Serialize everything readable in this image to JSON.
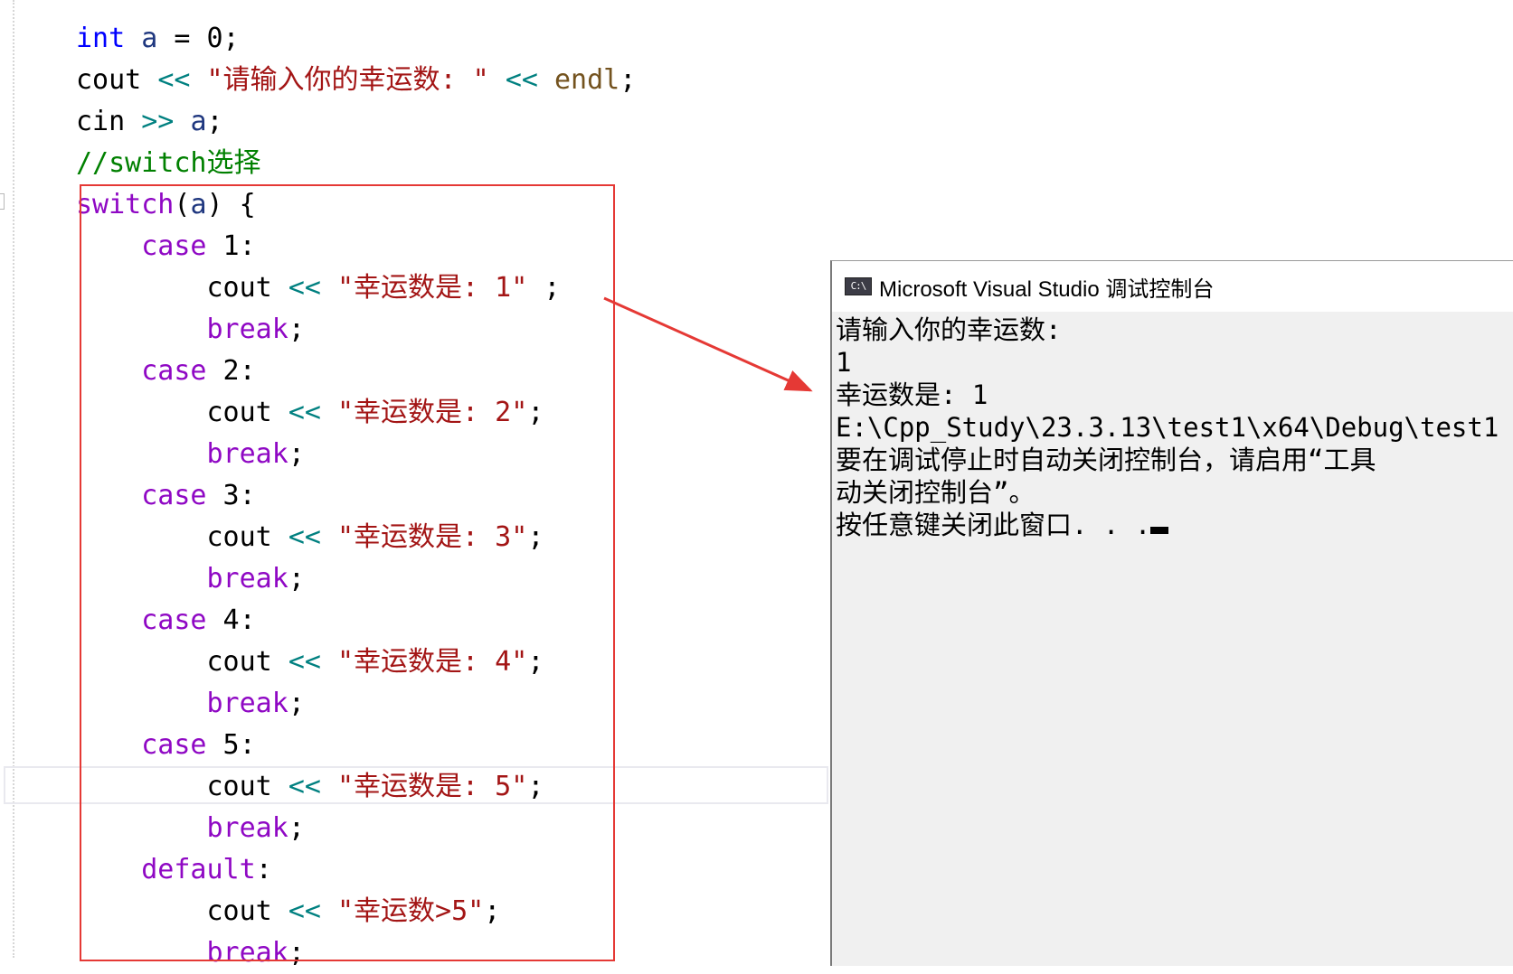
{
  "editor": {
    "lines": [
      [
        {
          "c": "kw",
          "t": "int"
        },
        {
          "c": "",
          "t": " "
        },
        {
          "c": "var",
          "t": "a"
        },
        {
          "c": "",
          "t": " = 0;"
        }
      ],
      [
        {
          "c": "",
          "t": "cout "
        },
        {
          "c": "op",
          "t": "<<"
        },
        {
          "c": "",
          "t": " "
        },
        {
          "c": "str",
          "t": "\"请输入你的幸运数: \""
        },
        {
          "c": "",
          "t": " "
        },
        {
          "c": "op",
          "t": "<<"
        },
        {
          "c": "",
          "t": " "
        },
        {
          "c": "fn",
          "t": "endl"
        },
        {
          "c": "",
          "t": ";"
        }
      ],
      [
        {
          "c": "",
          "t": "cin "
        },
        {
          "c": "op",
          "t": ">>"
        },
        {
          "c": "",
          "t": " "
        },
        {
          "c": "var",
          "t": "a"
        },
        {
          "c": "",
          "t": ";"
        }
      ],
      [
        {
          "c": "cmt",
          "t": "//switch选择"
        }
      ],
      [
        {
          "c": "ctl",
          "t": "switch"
        },
        {
          "c": "",
          "t": "("
        },
        {
          "c": "var",
          "t": "a"
        },
        {
          "c": "",
          "t": ") {"
        }
      ],
      [
        {
          "c": "",
          "t": "    "
        },
        {
          "c": "ctl",
          "t": "case"
        },
        {
          "c": "",
          "t": " 1:"
        }
      ],
      [
        {
          "c": "",
          "t": "        cout "
        },
        {
          "c": "op",
          "t": "<<"
        },
        {
          "c": "",
          "t": " "
        },
        {
          "c": "str",
          "t": "\"幸运数是: 1\""
        },
        {
          "c": "",
          "t": " ;"
        }
      ],
      [
        {
          "c": "",
          "t": "        "
        },
        {
          "c": "ctl",
          "t": "break"
        },
        {
          "c": "",
          "t": ";"
        }
      ],
      [
        {
          "c": "",
          "t": "    "
        },
        {
          "c": "ctl",
          "t": "case"
        },
        {
          "c": "",
          "t": " 2:"
        }
      ],
      [
        {
          "c": "",
          "t": "        cout "
        },
        {
          "c": "op",
          "t": "<<"
        },
        {
          "c": "",
          "t": " "
        },
        {
          "c": "str",
          "t": "\"幸运数是: 2\""
        },
        {
          "c": "",
          "t": ";"
        }
      ],
      [
        {
          "c": "",
          "t": "        "
        },
        {
          "c": "ctl",
          "t": "break"
        },
        {
          "c": "",
          "t": ";"
        }
      ],
      [
        {
          "c": "",
          "t": "    "
        },
        {
          "c": "ctl",
          "t": "case"
        },
        {
          "c": "",
          "t": " 3:"
        }
      ],
      [
        {
          "c": "",
          "t": "        cout "
        },
        {
          "c": "op",
          "t": "<<"
        },
        {
          "c": "",
          "t": " "
        },
        {
          "c": "str",
          "t": "\"幸运数是: 3\""
        },
        {
          "c": "",
          "t": ";"
        }
      ],
      [
        {
          "c": "",
          "t": "        "
        },
        {
          "c": "ctl",
          "t": "break"
        },
        {
          "c": "",
          "t": ";"
        }
      ],
      [
        {
          "c": "",
          "t": "    "
        },
        {
          "c": "ctl",
          "t": "case"
        },
        {
          "c": "",
          "t": " 4:"
        }
      ],
      [
        {
          "c": "",
          "t": "        cout "
        },
        {
          "c": "op",
          "t": "<<"
        },
        {
          "c": "",
          "t": " "
        },
        {
          "c": "str",
          "t": "\"幸运数是: 4\""
        },
        {
          "c": "",
          "t": ";"
        }
      ],
      [
        {
          "c": "",
          "t": "        "
        },
        {
          "c": "ctl",
          "t": "break"
        },
        {
          "c": "",
          "t": ";"
        }
      ],
      [
        {
          "c": "",
          "t": "    "
        },
        {
          "c": "ctl",
          "t": "case"
        },
        {
          "c": "",
          "t": " 5:"
        }
      ],
      [
        {
          "c": "",
          "t": "        cout "
        },
        {
          "c": "op",
          "t": "<<"
        },
        {
          "c": "",
          "t": " "
        },
        {
          "c": "str",
          "t": "\"幸运数是: 5\""
        },
        {
          "c": "",
          "t": ";"
        }
      ],
      [
        {
          "c": "",
          "t": "        "
        },
        {
          "c": "ctl",
          "t": "break"
        },
        {
          "c": "",
          "t": ";"
        }
      ],
      [
        {
          "c": "",
          "t": "    "
        },
        {
          "c": "ctl",
          "t": "default"
        },
        {
          "c": "",
          "t": ":"
        }
      ],
      [
        {
          "c": "",
          "t": "        cout "
        },
        {
          "c": "op",
          "t": "<<"
        },
        {
          "c": "",
          "t": " "
        },
        {
          "c": "str",
          "t": "\"幸运数>5\""
        },
        {
          "c": "",
          "t": ";"
        }
      ],
      [
        {
          "c": "",
          "t": "        "
        },
        {
          "c": "ctl",
          "t": "break"
        },
        {
          "c": "",
          "t": ";"
        }
      ]
    ]
  },
  "annotation": {
    "box_color": "#e53935",
    "arrow_color": "#e53935"
  },
  "console": {
    "icon_text": "C:\\",
    "title": "Microsoft Visual Studio 调试控制台",
    "lines": [
      "请输入你的幸运数:",
      "1",
      "幸运数是: 1",
      "E:\\Cpp_Study\\23.3.13\\test1\\x64\\Debug\\test1",
      "要在调试停止时自动关闭控制台，请启用“工具",
      "动关闭控制台”。",
      "按任意键关闭此窗口. . ."
    ]
  }
}
